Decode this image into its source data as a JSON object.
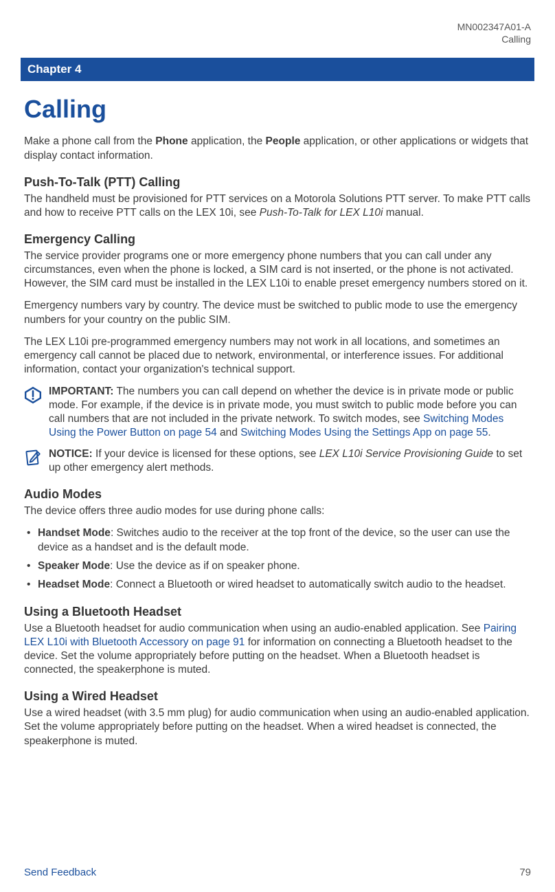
{
  "header": {
    "doc_id": "MN002347A01-A",
    "section": "Calling"
  },
  "chapter_bar": "Chapter 4",
  "title": "Calling",
  "intro": {
    "pre": "Make a phone call from the ",
    "b1": "Phone",
    "mid": " application, the ",
    "b2": "People",
    "post": " application, or other applications or widgets that display contact information."
  },
  "ptt": {
    "heading": "Push-To-Talk (PTT) Calling",
    "p1a": "The handheld must be provisioned for PTT services on a Motorola Solutions PTT server. To make PTT calls and how to receive PTT calls on the LEX 10i, see ",
    "p1i": "Push-To-Talk for LEX L10i",
    "p1b": " manual."
  },
  "emergency": {
    "heading": "Emergency Calling",
    "p1": "The service provider programs one or more emergency phone numbers that you can call under any circumstances, even when the phone is locked, a SIM card is not inserted, or the phone is not activated. However, the SIM card must be installed in the LEX L10i to enable preset emergency numbers stored on it.",
    "p2": "Emergency numbers vary by country. The device must be switched to public mode to use the emergency numbers for your country on the public SIM.",
    "p3": "The LEX L10i pre-programmed emergency numbers may not work in all locations, and sometimes an emergency call cannot be placed due to network, environmental, or interference issues. For additional information, contact your organization's technical support."
  },
  "important": {
    "label": "IMPORTANT:",
    "t1": " The numbers you can call depend on whether the device is in private mode or public mode. For example, if the device is in private mode, you must switch to public mode before you can call numbers that are not included in the private network. To switch modes, see ",
    "link1": "Switching Modes Using the Power Button on page 54",
    "t2": " and ",
    "link2": "Switching Modes Using the Settings App on page 55",
    "t3": "."
  },
  "notice": {
    "label": "NOTICE:",
    "t1": " If your device is licensed for these options, see ",
    "i1": "LEX L10i Service Provisioning Guide",
    "t2": " to set up other emergency alert methods."
  },
  "audio": {
    "heading": "Audio Modes",
    "intro": "The device offers three audio modes for use during phone calls:",
    "items": [
      {
        "b": "Handset Mode",
        "t": ": Switches audio to the receiver at the top front of the device, so the user can use the device as a handset and is the default mode."
      },
      {
        "b": "Speaker Mode",
        "t": ": Use the device as if on speaker phone."
      },
      {
        "b": "Headset Mode",
        "t": ": Connect a Bluetooth or wired headset to automatically switch audio to the headset."
      }
    ]
  },
  "bluetooth": {
    "heading": "Using a Bluetooth Headset",
    "p1a": "Use a Bluetooth headset for audio communication when using an audio-enabled application. See ",
    "link": "Pairing LEX L10i with Bluetooth Accessory on page 91",
    "p1b": " for information on connecting a Bluetooth headset to the device. Set the volume appropriately before putting on the headset. When a Bluetooth headset is connected, the speakerphone is muted."
  },
  "wired": {
    "heading": "Using a Wired Headset",
    "p1": "Use a wired headset (with 3.5 mm plug) for audio communication when using an audio-enabled application. Set the volume appropriately before putting on the headset. When a wired headset is connected, the speakerphone is muted."
  },
  "footer": {
    "feedback": "Send Feedback",
    "page": "79"
  }
}
